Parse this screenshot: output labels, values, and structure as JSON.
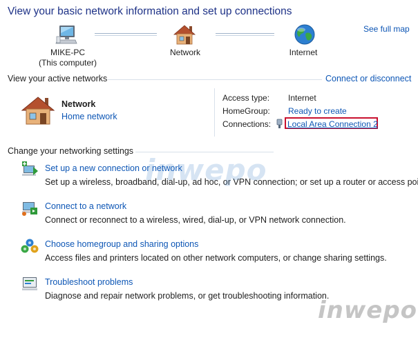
{
  "header": {
    "title": "View your basic network information and set up connections"
  },
  "map": {
    "see_full_map": "See full map",
    "nodes": [
      {
        "name": "MIKE-PC",
        "sub": "(This computer)",
        "icon": "computer-icon"
      },
      {
        "name": "Network",
        "sub": "",
        "icon": "house-icon"
      },
      {
        "name": "Internet",
        "sub": "",
        "icon": "globe-icon"
      }
    ]
  },
  "active": {
    "heading": "View your active networks",
    "connect_link": "Connect or disconnect",
    "network_name": "Network",
    "network_type": "Home network",
    "access_type_label": "Access type:",
    "access_type_value": "Internet",
    "homegroup_label": "HomeGroup:",
    "homegroup_value": "Ready to create",
    "connections_label": "Connections:",
    "connections_value": "Local Area Connection 2",
    "highlight_color": "#c8102e"
  },
  "settings": {
    "heading": "Change your networking settings",
    "tasks": [
      {
        "title": "Set up a new connection or network",
        "desc": "Set up a wireless, broadband, dial-up, ad hoc, or VPN connection; or set up a router or access point.",
        "icon": "new-connection-icon"
      },
      {
        "title": "Connect to a network",
        "desc": "Connect or reconnect to a wireless, wired, dial-up, or VPN network connection.",
        "icon": "connect-network-icon"
      },
      {
        "title": "Choose homegroup and sharing options",
        "desc": "Access files and printers located on other network computers, or change sharing settings.",
        "icon": "homegroup-icon"
      },
      {
        "title": "Troubleshoot problems",
        "desc": "Diagnose and repair network problems, or get troubleshooting information.",
        "icon": "troubleshoot-icon"
      }
    ]
  },
  "watermark": {
    "text": "inwepo"
  }
}
